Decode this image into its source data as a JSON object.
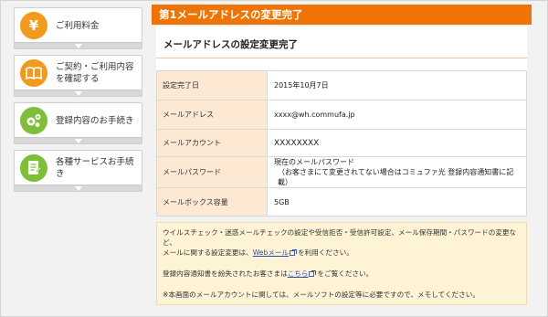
{
  "sidebar": {
    "items": [
      {
        "label": "ご利用料金",
        "color": "#f29a1e",
        "icon": "yen-icon"
      },
      {
        "label": "ご契約・ご利用内容を確認する",
        "color": "#f29a1e",
        "icon": "book-icon"
      },
      {
        "label": "登録内容のお手続き",
        "color": "#7fbe3a",
        "icon": "gears-icon"
      },
      {
        "label": "各種サービスお手続き",
        "color": "#7fbe3a",
        "icon": "document-icon"
      }
    ]
  },
  "main": {
    "title": "第1メールアドレスの変更完了",
    "subtitle": "メールアドレスの設定変更完了",
    "rows": [
      {
        "label": "設定完了日",
        "value": "2015年10月7日"
      },
      {
        "label": "メールアドレス",
        "value": "xxxx@wh.commufa.jp"
      },
      {
        "label": "メールアカウント",
        "value": "XXXXXXXX"
      },
      {
        "label": "メールパスワード",
        "value": "現在のメールパスワード",
        "value2": "（お客さまにて変更されてない場合はコミュファ光 登録内容通知書に記載）"
      },
      {
        "label": "メールボックス容量",
        "value": "5GB"
      }
    ]
  },
  "notice": {
    "line1": "ウイルスチェック・迷惑メールチェックの設定や受信拒否・受信許可設定、メール保存期間・パスワードの変更など、",
    "line2_pre": "メールに関する設定変更は、",
    "line2_link": "Webメール",
    "line2_post": "を利用ください。",
    "line3_pre": "登録内容通知書を紛失されたお客さまは",
    "line3_link": "こちら",
    "line3_post": "をご覧ください。",
    "line4": "※本画面のメールアカウントに関しては、メールソフトの設定等に必要ですので、メモしてください。"
  },
  "colors": {
    "accent": "#ee7505",
    "table_header_bg": "#fde8d4",
    "notice_bg": "#fff3d6",
    "link": "#2c4fa8"
  }
}
